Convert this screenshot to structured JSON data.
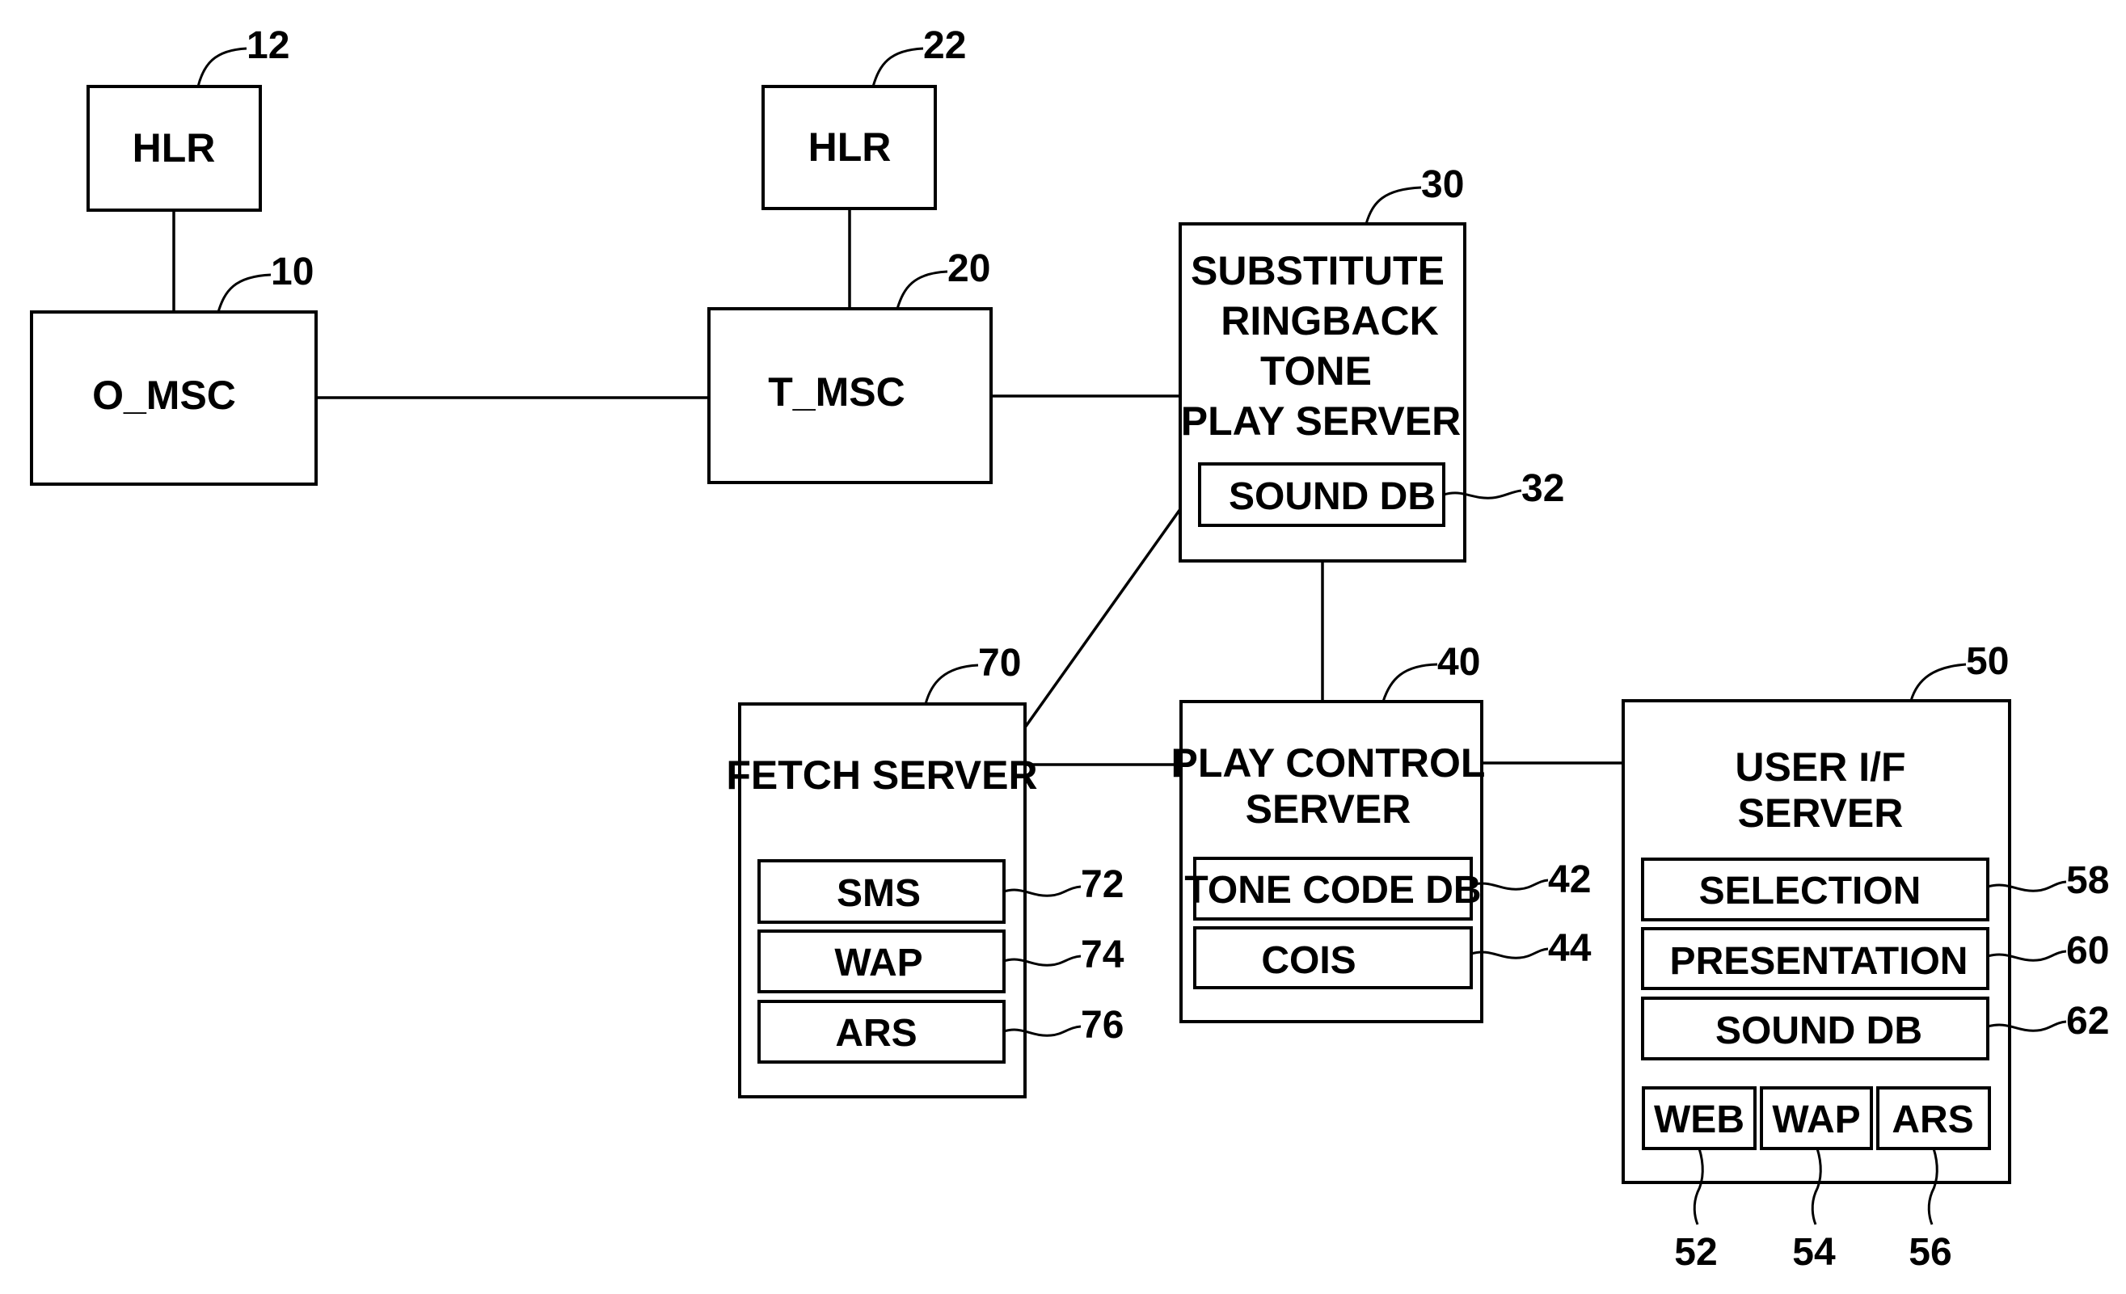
{
  "diagram": {
    "nodes": {
      "hlr12": {
        "label": "HLR",
        "ref": "12"
      },
      "omsc": {
        "label": "O_MSC",
        "ref": "10"
      },
      "hlr22": {
        "label": "HLR",
        "ref": "22"
      },
      "tmsc": {
        "label": "T_MSC",
        "ref": "20"
      },
      "srtps": {
        "lines": [
          "SUBSTITUTE",
          "RINGBACK",
          "TONE",
          "PLAY SERVER"
        ],
        "ref": "30",
        "sub": [
          {
            "label": "SOUND DB",
            "ref": "32"
          }
        ]
      },
      "fetch": {
        "lines": [
          "FETCH SERVER"
        ],
        "ref": "70",
        "sub": [
          {
            "label": "SMS",
            "ref": "72"
          },
          {
            "label": "WAP",
            "ref": "74"
          },
          {
            "label": "ARS",
            "ref": "76"
          }
        ]
      },
      "playctl": {
        "lines": [
          "PLAY CONTROL",
          "SERVER"
        ],
        "ref": "40",
        "sub": [
          {
            "label": "TONE CODE DB",
            "ref": "42"
          },
          {
            "label": "COIS",
            "ref": "44"
          }
        ]
      },
      "userif": {
        "lines": [
          "USER I/F",
          "SERVER"
        ],
        "ref": "50",
        "sub": [
          {
            "label": "SELECTION",
            "ref": "58"
          },
          {
            "label": "PRESENTATION",
            "ref": "60"
          },
          {
            "label": "SOUND DB",
            "ref": "62"
          }
        ],
        "ports": [
          {
            "label": "WEB",
            "ref": "52"
          },
          {
            "label": "WAP",
            "ref": "54"
          },
          {
            "label": "ARS",
            "ref": "56"
          }
        ]
      }
    },
    "edges": [
      [
        "hlr12",
        "omsc"
      ],
      [
        "hlr22",
        "tmsc"
      ],
      [
        "omsc",
        "tmsc"
      ],
      [
        "tmsc",
        "srtps"
      ],
      [
        "srtps",
        "fetch"
      ],
      [
        "srtps",
        "playctl"
      ],
      [
        "fetch",
        "playctl"
      ],
      [
        "playctl",
        "userif"
      ]
    ]
  }
}
